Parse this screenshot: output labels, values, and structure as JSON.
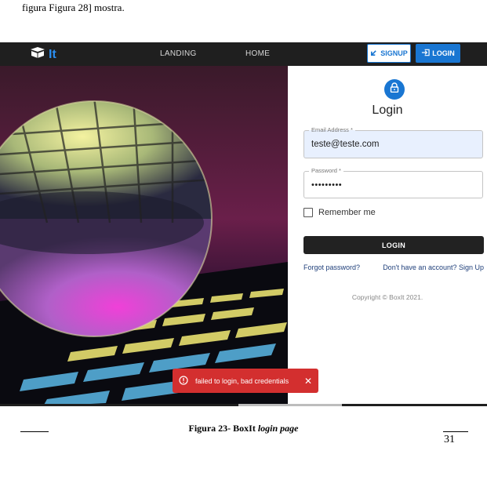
{
  "document": {
    "top_text": "figura Figura 28] mostra.",
    "caption_bold": "Figura 23- BoxIt ",
    "caption_italic": "login page",
    "page_number": "31"
  },
  "app": {
    "logo_text": "It",
    "nav": {
      "landing": "LANDING",
      "home": "HOME"
    },
    "signup_button": "SIGNUP",
    "login_button": "LOGIN"
  },
  "login": {
    "title": "Login",
    "email_label": "Email Address *",
    "email_value": "teste@teste.com",
    "password_label": "Password *",
    "password_value": "•••••••••",
    "remember_label": "Remember me",
    "submit_label": "LOGIN",
    "forgot_link": "Forgot password?",
    "signup_link": "Don't have an account? Sign Up",
    "copyright": "Copyright © BoxIt 2021."
  },
  "snackbar": {
    "message": "failed to login, bad credentials",
    "close": "✕"
  },
  "colors": {
    "accent": "#1976d2",
    "appbar": "#1f1f1f",
    "error": "#d32f2f",
    "autofill": "#e8f0fe"
  },
  "icons": [
    "box-icon",
    "signup-arrow-icon",
    "login-arrow-icon",
    "lock-icon",
    "error-circle-icon",
    "close-icon"
  ]
}
